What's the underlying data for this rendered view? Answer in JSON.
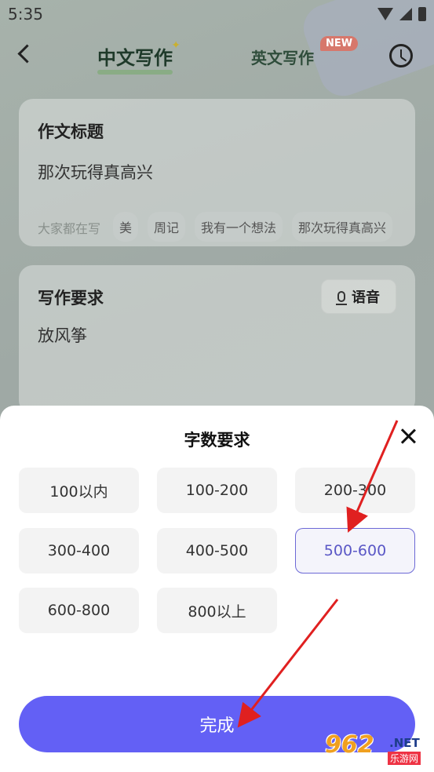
{
  "status_bar": {
    "time": "5:35"
  },
  "header": {
    "tab_chinese": "中文写作",
    "tab_english": "英文写作",
    "new_badge": "NEW"
  },
  "title_card": {
    "label": "作文标题",
    "value": "那次玩得真高兴",
    "suggestion_label": "大家都在写",
    "chips": [
      "美",
      "周记",
      "我有一个想法",
      "那次玩得真高兴"
    ]
  },
  "requirement_card": {
    "label": "写作要求",
    "value": "放风筝",
    "voice_label": "语音"
  },
  "word_count_sheet": {
    "title": "字数要求",
    "options": [
      "100以内",
      "100-200",
      "200-300",
      "300-400",
      "400-500",
      "500-600",
      "600-800",
      "800以上"
    ],
    "selected": "500-600",
    "done_label": "完成"
  },
  "watermark": {
    "logo": "962",
    "suffix": ".NET",
    "subtitle": "乐游网"
  },
  "colors": {
    "accent": "#6360f5",
    "selected_border": "#6c69d6",
    "arrow": "#e02020"
  }
}
